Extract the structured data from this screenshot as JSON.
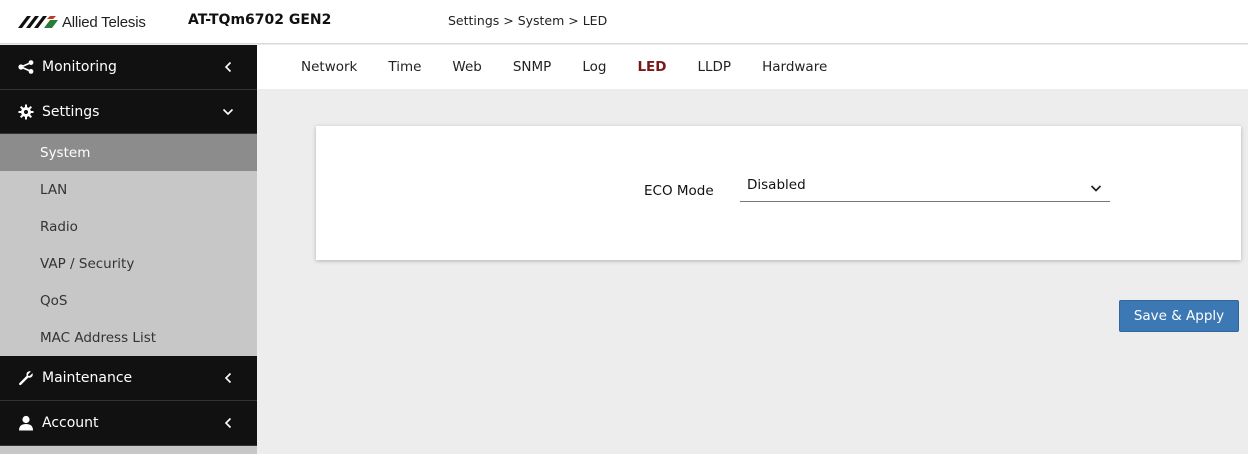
{
  "header": {
    "brand": "Allied Telesis",
    "model": "AT-TQm6702 GEN2",
    "breadcrumb": "Settings > System > LED"
  },
  "sidebar": {
    "monitoring": {
      "label": "Monitoring",
      "icon": "share-icon"
    },
    "settings": {
      "label": "Settings",
      "icon": "gear-icon",
      "items": [
        {
          "label": "System",
          "active": true
        },
        {
          "label": "LAN"
        },
        {
          "label": "Radio"
        },
        {
          "label": "VAP / Security"
        },
        {
          "label": "QoS"
        },
        {
          "label": "MAC Address List"
        }
      ]
    },
    "maintenance": {
      "label": "Maintenance",
      "icon": "wrench-icon"
    },
    "account": {
      "label": "Account",
      "icon": "user-icon"
    }
  },
  "tabs": [
    {
      "label": "Network"
    },
    {
      "label": "Time"
    },
    {
      "label": "Web"
    },
    {
      "label": "SNMP"
    },
    {
      "label": "Log"
    },
    {
      "label": "LED",
      "active": true
    },
    {
      "label": "LLDP"
    },
    {
      "label": "Hardware"
    }
  ],
  "form": {
    "eco_mode_label": "ECO Mode",
    "eco_mode_value": "Disabled"
  },
  "actions": {
    "save_apply_label": "Save & Apply"
  },
  "colors": {
    "active_tab": "#7a1818",
    "button": "#3c78b4",
    "sidebar_header": "#111111",
    "sidebar_active": "#8c8c8c"
  }
}
